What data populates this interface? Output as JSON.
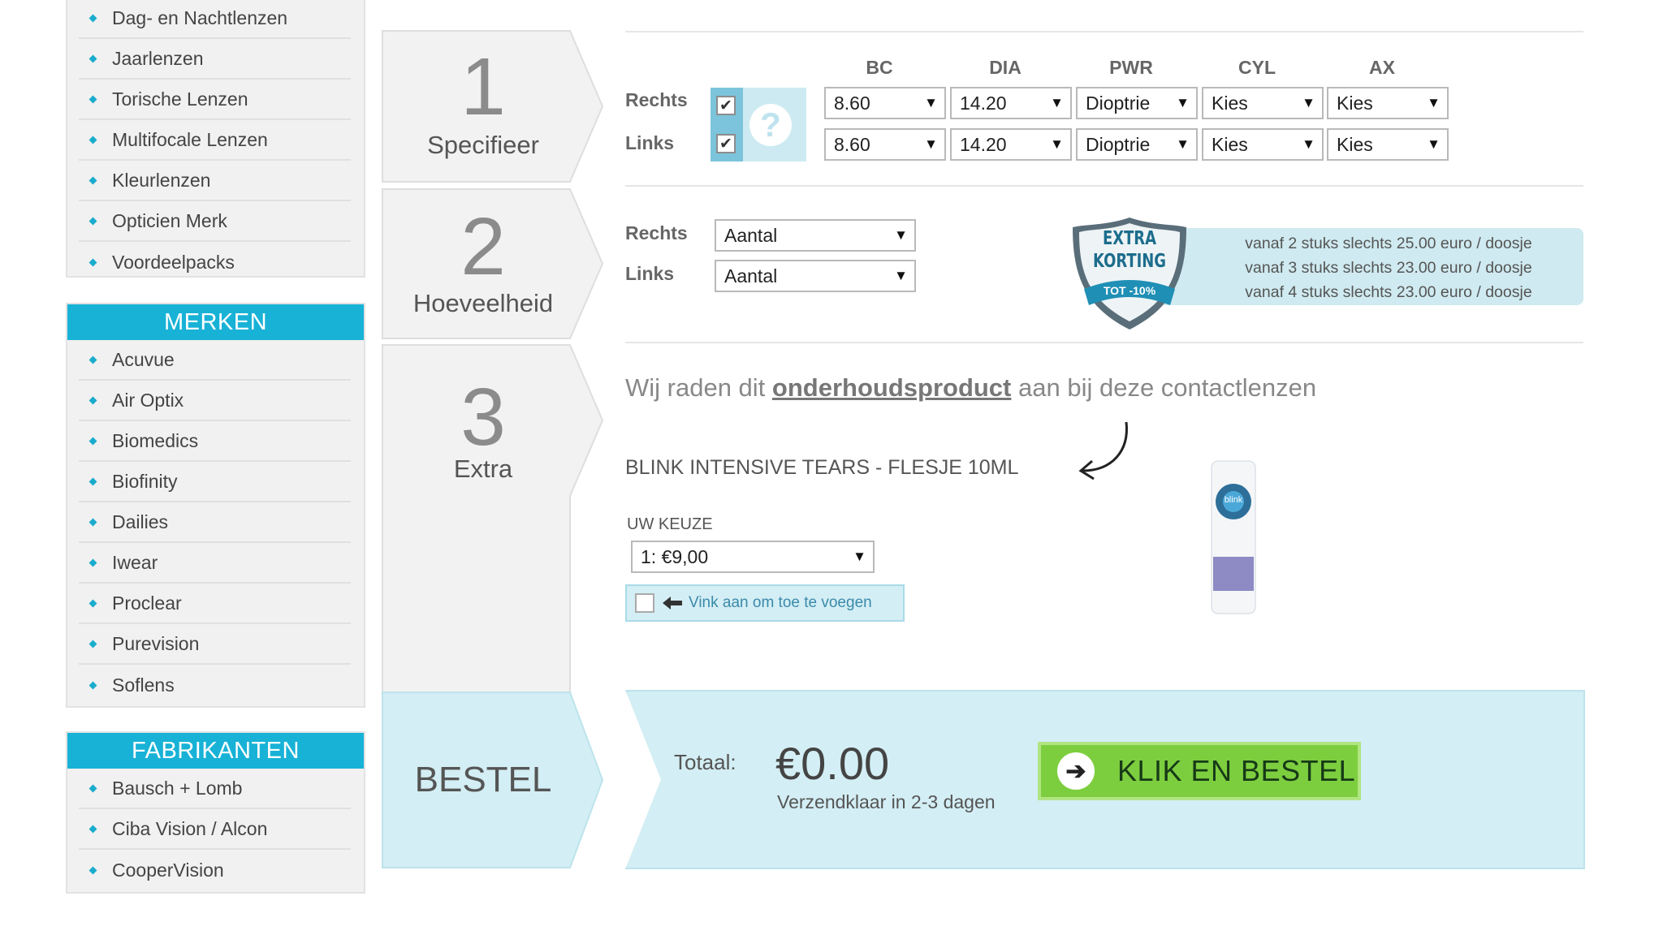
{
  "sidebar": {
    "top_items": [
      {
        "label": "Dag- en Nachtlenzen"
      },
      {
        "label": "Jaarlenzen"
      },
      {
        "label": "Torische Lenzen"
      },
      {
        "label": "Multifocale Lenzen"
      },
      {
        "label": "Kleurlenzen"
      },
      {
        "label": "Opticien Merk"
      },
      {
        "label": "Voordeelpacks"
      }
    ],
    "merken_title": "MERKEN",
    "merken": [
      {
        "label": "Acuvue"
      },
      {
        "label": "Air Optix"
      },
      {
        "label": "Biomedics"
      },
      {
        "label": "Biofinity"
      },
      {
        "label": "Dailies"
      },
      {
        "label": "Iwear"
      },
      {
        "label": "Proclear"
      },
      {
        "label": "Purevision"
      },
      {
        "label": "Soflens"
      }
    ],
    "fabrikanten_title": "FABRIKANTEN",
    "fabrikanten": [
      {
        "label": "Bausch + Lomb"
      },
      {
        "label": "Ciba Vision / Alcon"
      },
      {
        "label": "CooperVision"
      }
    ]
  },
  "steps": [
    {
      "num": "1",
      "label": "Specifieer"
    },
    {
      "num": "2",
      "label": "Hoeveelheid"
    },
    {
      "num": "3",
      "label": "Extra"
    },
    {
      "label": "BESTEL"
    }
  ],
  "spec": {
    "columns": [
      "BC",
      "DIA",
      "PWR",
      "CYL",
      "AX"
    ],
    "rechts_label": "Rechts",
    "links_label": "Links",
    "help_icon": "?",
    "rechts": {
      "checked": true,
      "values": [
        "8.60",
        "14.20",
        "Dioptrie",
        "Kies",
        "Kies"
      ]
    },
    "links": {
      "checked": true,
      "values": [
        "8.60",
        "14.20",
        "Dioptrie",
        "Kies",
        "Kies"
      ]
    }
  },
  "quantity": {
    "rechts_label": "Rechts",
    "links_label": "Links",
    "rechts_value": "Aantal",
    "links_value": "Aantal"
  },
  "korting": {
    "badge_line1": "EXTRA",
    "badge_line2": "KORTING",
    "badge_ribbon": "TOT -10%",
    "lines": [
      "vanaf 2 stuks slechts 25.00 euro / doosje",
      "vanaf 3 stuks slechts 23.00 euro / doosje",
      "vanaf 4 stuks slechts 23.00 euro / doosje"
    ]
  },
  "extra": {
    "recommend_pre": "Wij raden dit ",
    "recommend_link": "onderhoudsproduct",
    "recommend_post": " aan bij deze contactlenzen",
    "product_name": "BLINK INTENSIVE TEARS - FLESJE 10ML",
    "choice_label": "UW KEUZE",
    "choice_value": "1: €9,00",
    "add_label": "Vink aan om toe te voegen",
    "add_checked": false,
    "bottle_brand": "blink"
  },
  "order": {
    "total_label": "Totaal:",
    "total_value": "€0.00",
    "shipping": "Verzendklaar in 2-3 dagen",
    "button_label": "KLIK EN BESTEL"
  },
  "colors": {
    "accent": "#18b2d6",
    "button": "#7dce3f",
    "box": "#d3eef4"
  }
}
